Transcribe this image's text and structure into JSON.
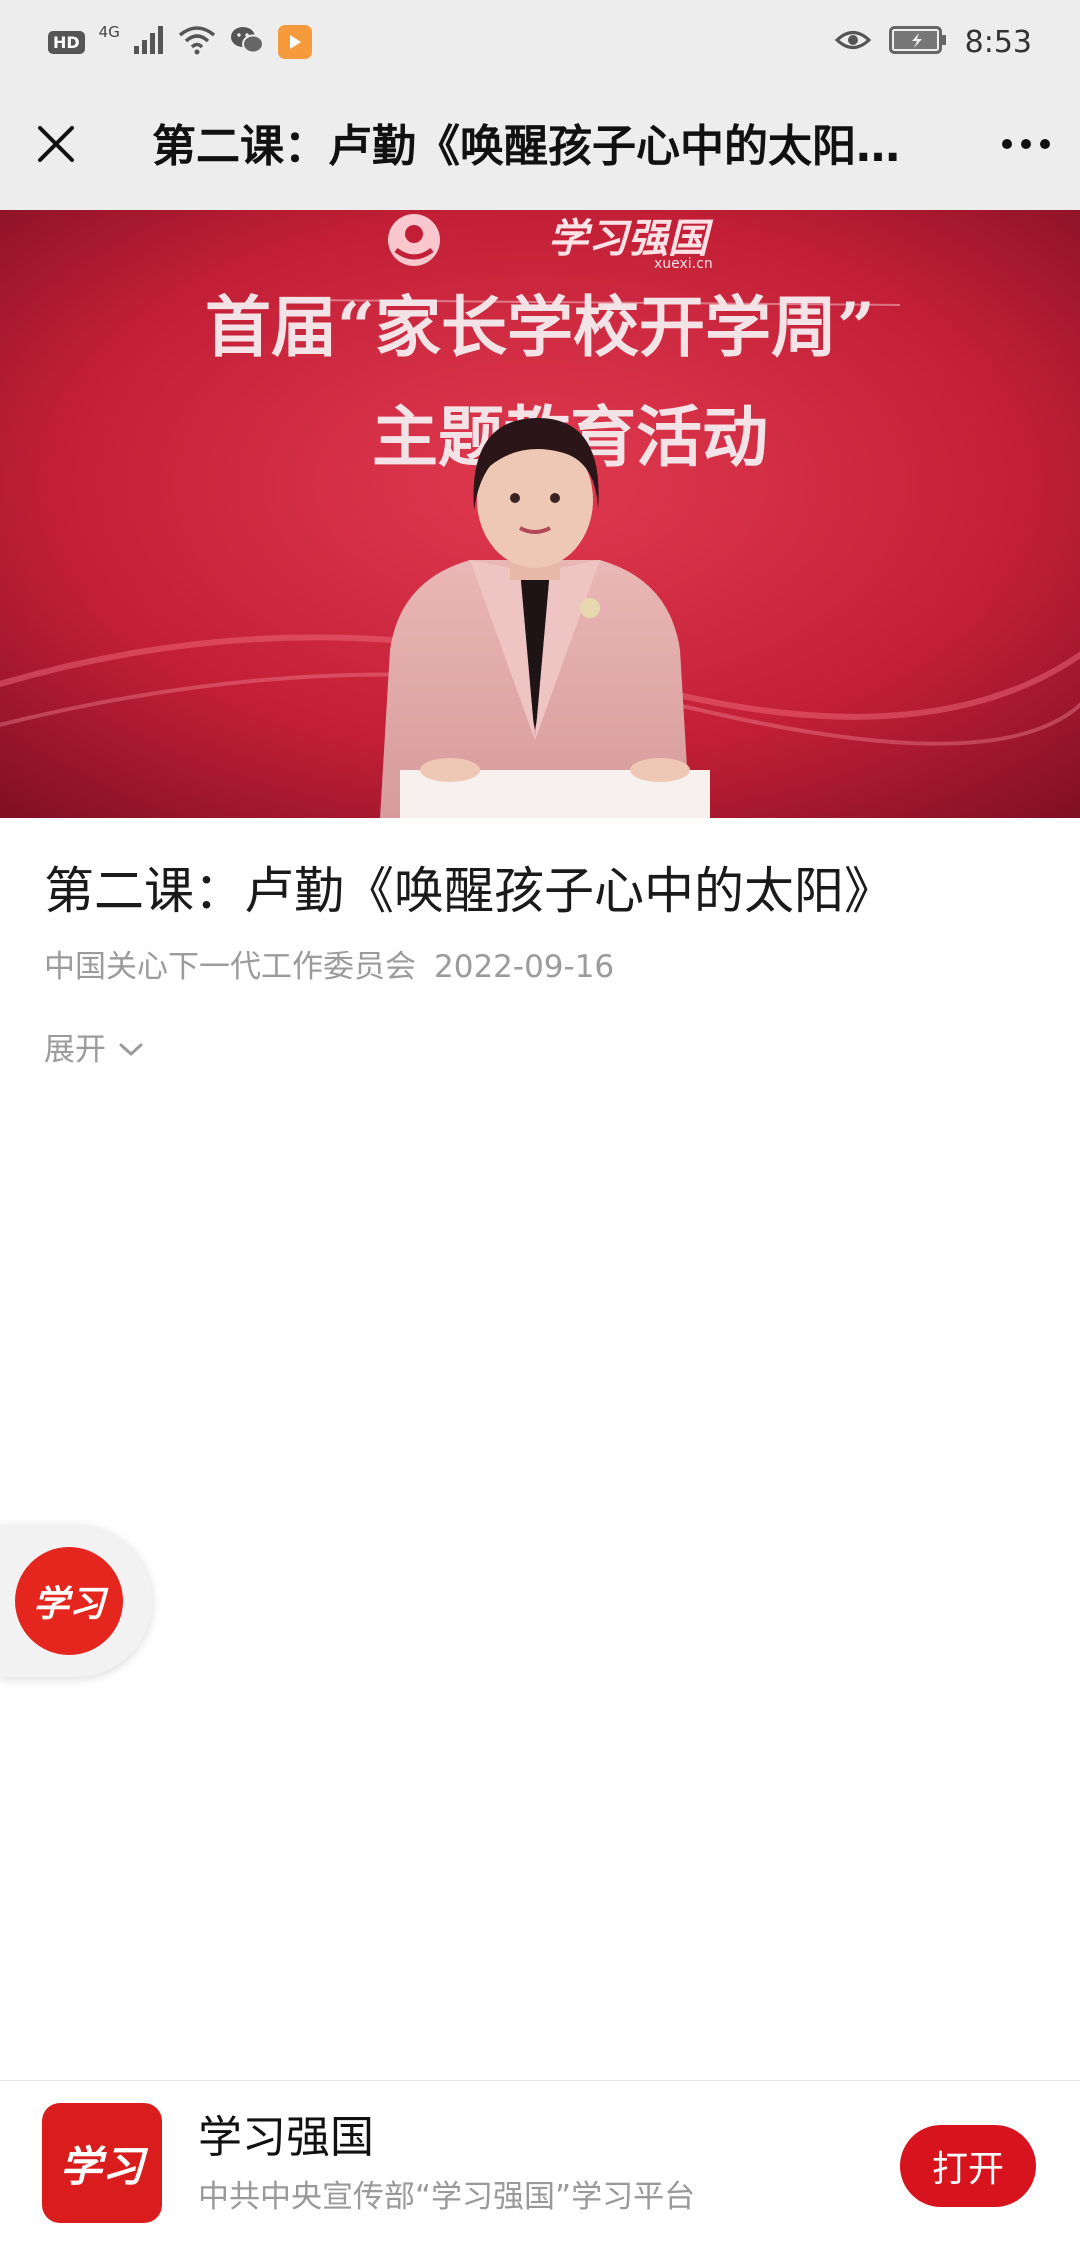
{
  "status_bar": {
    "hd": "HD",
    "network": "4G",
    "time": "8:53"
  },
  "nav": {
    "title": "第二课：卢勤《唤醒孩子心中的太阳…"
  },
  "video": {
    "site_logo": "学习强国",
    "site_url": "xuexi.cn",
    "banner_line1": "首届“家长学校开学周”",
    "banner_line2": "主题教育活动"
  },
  "article": {
    "title": "第二课：卢勤《唤醒孩子心中的太阳》",
    "source": "中国关心下一代工作委员会",
    "date": "2022-09-16",
    "expand_label": "展开"
  },
  "float_button": {
    "logo_text": "学习"
  },
  "app_banner": {
    "logo_text": "学习",
    "name": "学习强国",
    "description": "中共中央宣传部“学习强国”学习平台",
    "open_label": "打开"
  },
  "colors": {
    "brand_red": "#d7141e",
    "nav_bg": "#ededed"
  }
}
